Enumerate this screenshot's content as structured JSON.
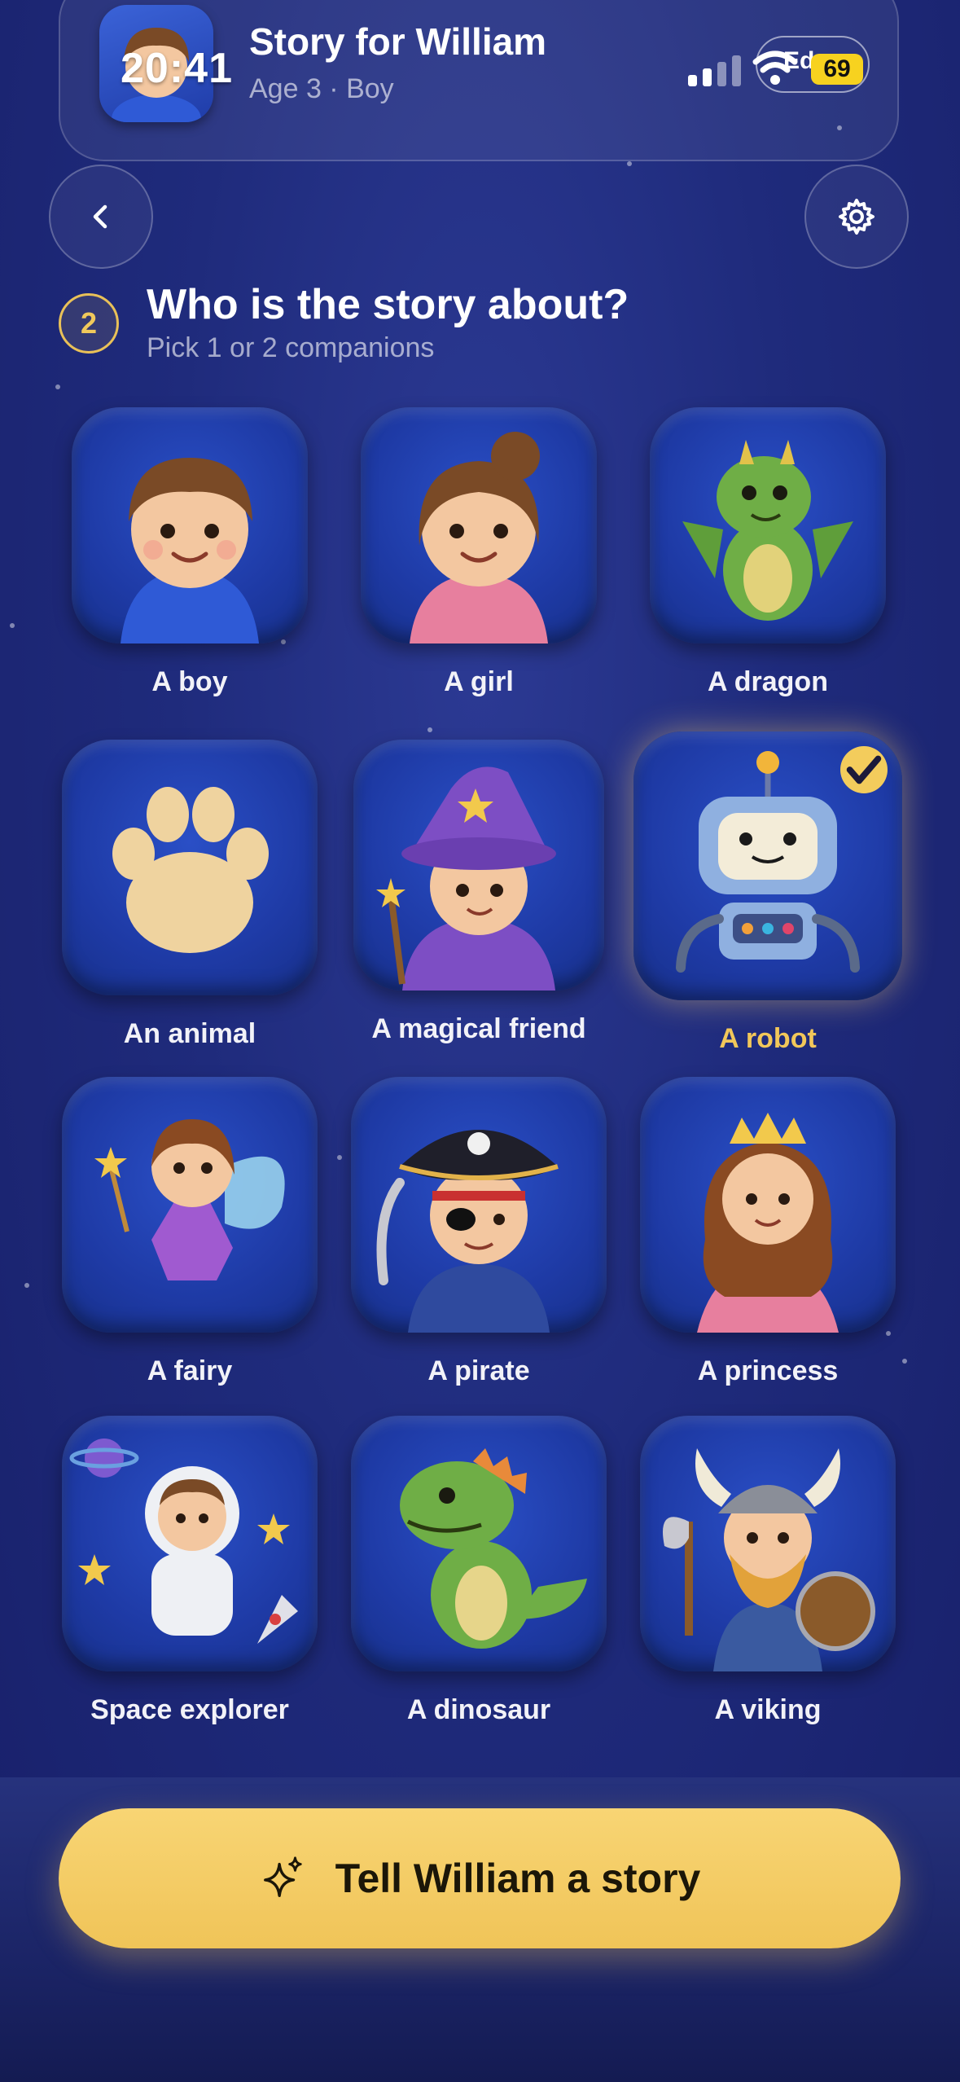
{
  "status_bar": {
    "time": "20:41",
    "carrier_label": "Ed",
    "battery": "69"
  },
  "header": {
    "title": "Story for William",
    "subtitle": "Age 3 · Boy",
    "avatar_icon": "boy-avatar-icon"
  },
  "nav": {
    "back_icon": "chevron-left-icon",
    "settings_icon": "gear-icon"
  },
  "step": {
    "number": "2",
    "question": "Who is the story about?",
    "hint": "Pick 1 or 2 companions"
  },
  "companions": [
    {
      "label": "A boy",
      "selected": false
    },
    {
      "label": "A girl",
      "selected": false
    },
    {
      "label": "A dragon",
      "selected": false
    },
    {
      "label": "An animal",
      "selected": false
    },
    {
      "label": "A magical friend",
      "selected": false
    },
    {
      "label": "A robot",
      "selected": true
    },
    {
      "label": "A fairy",
      "selected": false
    },
    {
      "label": "A pirate",
      "selected": false
    },
    {
      "label": "A princess",
      "selected": false
    },
    {
      "label": "Space explorer",
      "selected": false
    },
    {
      "label": "A dinosaur",
      "selected": false
    },
    {
      "label": "A viking",
      "selected": false
    }
  ],
  "cta": {
    "label": "Tell William a story",
    "icon": "sparkle-icon"
  },
  "colors": {
    "accent": "#f3cc5c",
    "background": "#1f2b7c",
    "tile": "#1e3aa5"
  }
}
